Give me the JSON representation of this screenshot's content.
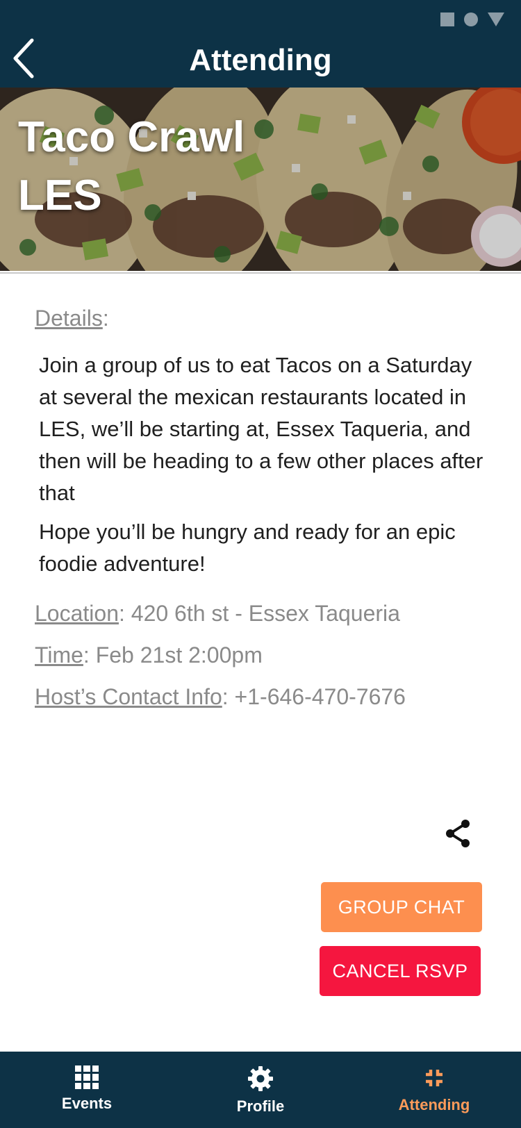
{
  "header": {
    "title": "Attending",
    "back_icon": "chevron-left-icon"
  },
  "event": {
    "title_line1": "Taco Crawl",
    "title_line2": "LES",
    "details_label": "Details",
    "details_colon": ":",
    "description": [
      "Join a group of us to eat Tacos on a Saturday at several the mexican restaurants located in LES, we’ll be starting at, Essex Taqueria, and then will be heading to a few other places after that",
      "Hope you’ll be hungry and ready for an epic foodie adventure!"
    ],
    "location_label": "Location",
    "location_value": ": 420 6th st - Essex Taqueria",
    "time_label": "Time",
    "time_value": ": Feb 21st 2:00pm",
    "host_label": "Host’s Contact Info",
    "host_value": ": +1-646-470-7676"
  },
  "actions": {
    "share_icon": "share-icon",
    "group_chat_label": "GROUP CHAT",
    "cancel_rsvp_label": "CANCEL RSVP"
  },
  "bottom_nav": {
    "items": [
      {
        "label": "Events",
        "icon": "grid-icon"
      },
      {
        "label": "Profile",
        "icon": "gear-icon"
      },
      {
        "label": "Attending",
        "icon": "compress-icon",
        "active": true
      }
    ]
  },
  "colors": {
    "primary_dark": "#0d3246",
    "accent_orange": "#fd8f4f",
    "danger_red": "#f5163f",
    "muted_text": "#8a8a8a"
  }
}
